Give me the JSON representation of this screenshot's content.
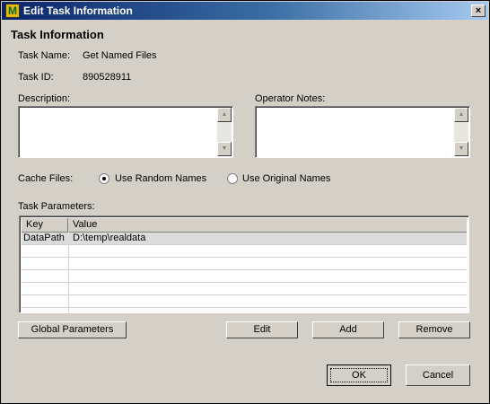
{
  "window": {
    "title": "Edit Task Information",
    "close_glyph": "×",
    "app_icon_letter": "M"
  },
  "form": {
    "heading": "Task Information",
    "task_name_label": "Task Name:",
    "task_name_value": "Get Named Files",
    "task_id_label": "Task ID:",
    "task_id_value": "890528911",
    "description_label": "Description:",
    "description_value": "",
    "operator_notes_label": "Operator Notes:",
    "operator_notes_value": "",
    "cache_files_label": "Cache Files:",
    "cache_options": [
      {
        "label": "Use Random Names",
        "selected": true
      },
      {
        "label": "Use Original Names",
        "selected": false
      }
    ],
    "task_parameters_label": "Task Parameters:"
  },
  "scroll_glyphs": {
    "up": "▲",
    "down": "▼"
  },
  "table": {
    "columns": [
      "Key",
      "Value"
    ],
    "rows": [
      {
        "key": "DataPath",
        "value": "D:\\temp\\realdata",
        "selected": true
      },
      {
        "key": "",
        "value": ""
      },
      {
        "key": "",
        "value": ""
      },
      {
        "key": "",
        "value": ""
      },
      {
        "key": "",
        "value": ""
      },
      {
        "key": "",
        "value": ""
      },
      {
        "key": "",
        "value": ""
      }
    ]
  },
  "buttons": {
    "global_parameters": "Global Parameters",
    "edit": "Edit",
    "add": "Add",
    "remove": "Remove",
    "ok": "OK",
    "cancel": "Cancel"
  }
}
